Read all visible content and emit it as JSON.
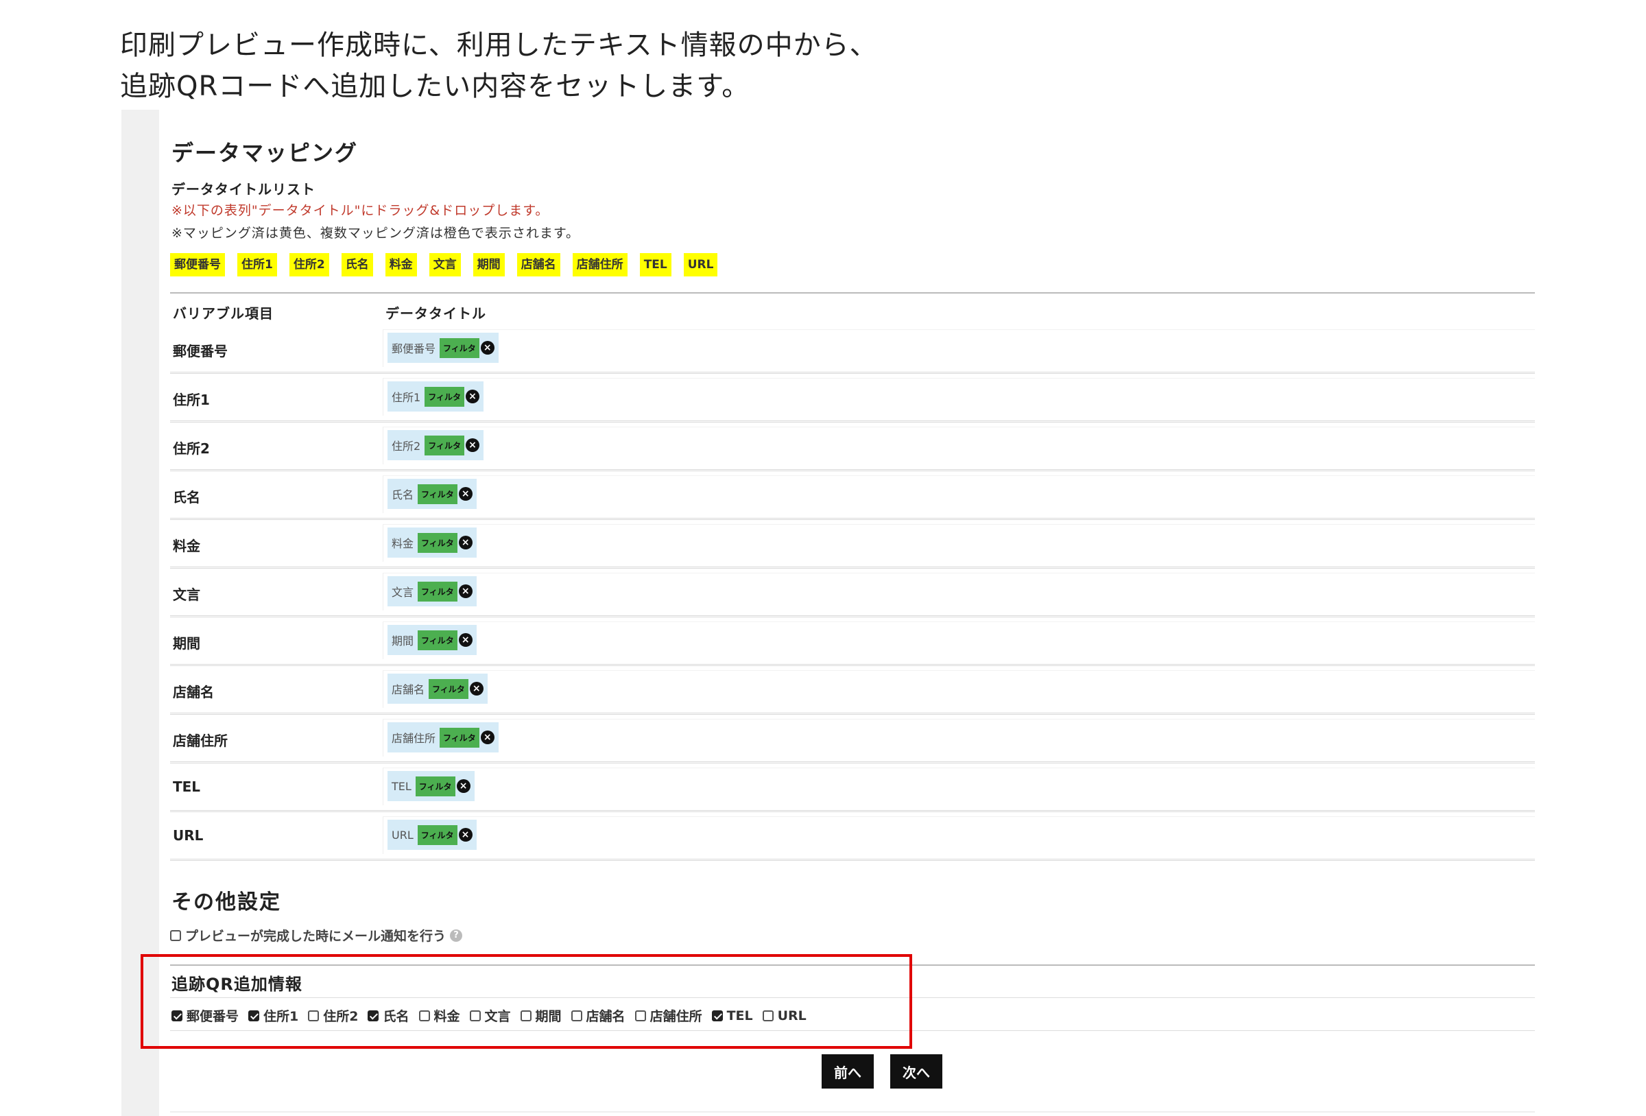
{
  "caption": {
    "line1": "印刷プレビュー作成時に、利用したテキスト情報の中から、",
    "line2": "追跡QRコードへ追加したい内容をセットします。"
  },
  "mapping": {
    "title": "データマッピング",
    "list_title": "データタイトルリスト",
    "note_red": "※以下の表列\"データタイトル\"にドラッグ&ドロップします。",
    "note": "※マッピング済は黄色、複数マッピング済は橙色で表示されます。",
    "chips": [
      "郵便番号",
      "住所1",
      "住所2",
      "氏名",
      "料金",
      "文言",
      "期間",
      "店舗名",
      "店舗住所",
      "TEL",
      "URL"
    ],
    "header_variable": "バリアブル項目",
    "header_data_title": "データタイトル",
    "filter_label": "フィルタ",
    "rows": [
      {
        "label": "郵便番号",
        "mapped": "郵便番号"
      },
      {
        "label": "住所1",
        "mapped": "住所1"
      },
      {
        "label": "住所2",
        "mapped": "住所2"
      },
      {
        "label": "氏名",
        "mapped": "氏名"
      },
      {
        "label": "料金",
        "mapped": "料金"
      },
      {
        "label": "文言",
        "mapped": "文言"
      },
      {
        "label": "期間",
        "mapped": "期間"
      },
      {
        "label": "店舗名",
        "mapped": "店舗名"
      },
      {
        "label": "店舗住所",
        "mapped": "店舗住所"
      },
      {
        "label": "TEL",
        "mapped": "TEL"
      },
      {
        "label": "URL",
        "mapped": "URL"
      }
    ]
  },
  "other": {
    "title": "その他設定",
    "notify_label": "プレビューが完成した時にメール通知を行う",
    "notify_checked": false,
    "help_icon": "?",
    "qr_title": "追跡QR追加情報",
    "qr_items": [
      {
        "label": "郵便番号",
        "checked": true
      },
      {
        "label": "住所1",
        "checked": true
      },
      {
        "label": "住所2",
        "checked": false
      },
      {
        "label": "氏名",
        "checked": true
      },
      {
        "label": "料金",
        "checked": false
      },
      {
        "label": "文言",
        "checked": false
      },
      {
        "label": "期間",
        "checked": false
      },
      {
        "label": "店舗名",
        "checked": false
      },
      {
        "label": "店舗住所",
        "checked": false
      },
      {
        "label": "TEL",
        "checked": true
      },
      {
        "label": "URL",
        "checked": false
      }
    ]
  },
  "buttons": {
    "prev": "前へ",
    "next": "次へ"
  },
  "colors": {
    "chip_bg": "#ffff00",
    "filter_bg": "#4caf50",
    "mapped_bg": "#d6ebf7",
    "highlight": "#e00000",
    "note_red": "#c0392b"
  }
}
